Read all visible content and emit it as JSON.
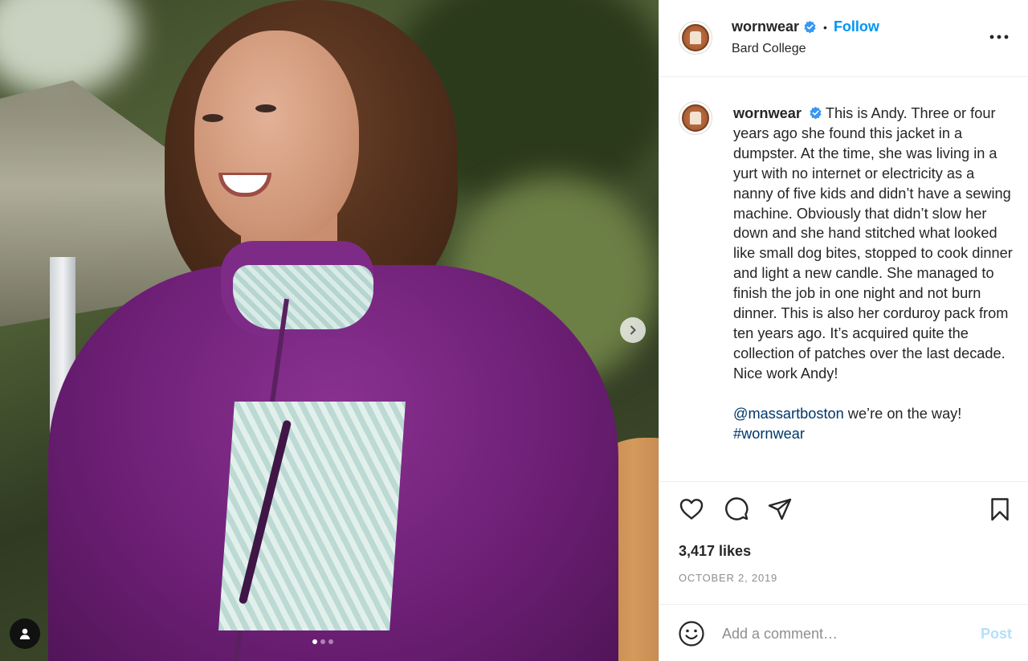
{
  "post": {
    "author": "wornwear",
    "follow_label": "Follow",
    "separator": "•",
    "location": "Bard College",
    "caption_paragraphs": [
      "This is Andy. Three or four years ago she found this jacket in a dumpster. At the time, she was living in a yurt with no internet or electricity as a nanny of five kids and didn’t have a sewing machine. Obviously that didn’t slow her down and she hand stitched what looked like small dog bites, stopped to cook dinner and light a new candle. She managed to finish the job in one night and not burn dinner. This is also her corduroy pack from ten years ago. It’s acquired quite the collection of patches over the last decade. Nice work Andy!"
    ],
    "mention": "@massartboston",
    "mention_suffix": " we’re on the way!",
    "hashtag": "#wornwear",
    "likes": "3,417 likes",
    "date": "OCTOBER 2, 2019"
  },
  "comment": {
    "placeholder": "Add a comment…",
    "post_label": "Post"
  },
  "carousel": {
    "slides": 3,
    "active_index": 0
  },
  "colors": {
    "follow": "#0095f6",
    "verified": "#3897f0",
    "link": "#00376b",
    "post_disabled": "#b2dffc",
    "muted": "#8e8e8e"
  },
  "icons": {
    "verified": "verified-badge-icon",
    "more": "more-options-icon",
    "like": "heart-icon",
    "comment": "comment-icon",
    "share": "send-icon",
    "save": "bookmark-icon",
    "emoji": "emoji-icon",
    "next": "chevron-right-icon",
    "tags": "user-tag-icon"
  }
}
